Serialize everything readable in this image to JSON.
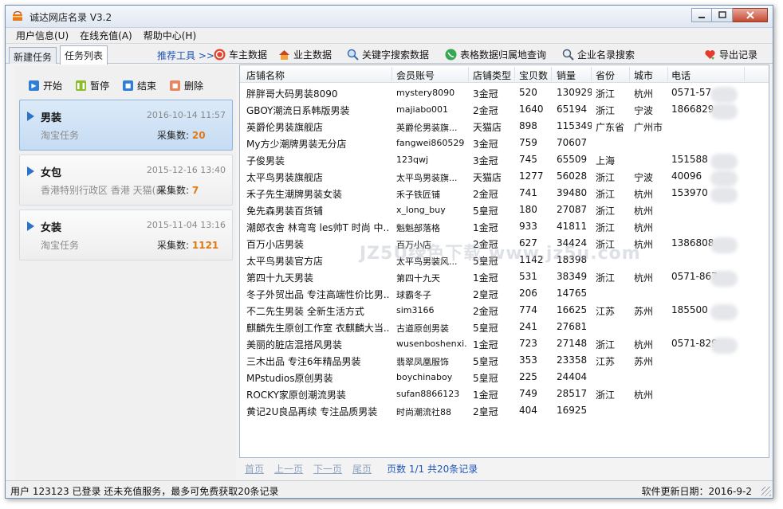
{
  "window": {
    "title": "诚达网店名录 V3.2"
  },
  "menu": [
    "用户信息(U)",
    "在线充值(A)",
    "帮助中心(H)"
  ],
  "tabs": [
    "新建任务",
    "任务列表"
  ],
  "tools": {
    "label": "推荐工具 >>",
    "items": [
      "车主数据",
      "业主数据",
      "关键字搜索数据",
      "表格数据归属地查询",
      "企业名录搜索"
    ],
    "export": "导出记录"
  },
  "actions": [
    "开始",
    "暂停",
    "结束",
    "删除"
  ],
  "tasks": [
    {
      "name": "男装",
      "date": "2016-10-14 11:57",
      "source": "淘宝任务",
      "count_label": "采集数:",
      "count": "20"
    },
    {
      "name": "女包",
      "date": "2015-12-16 13:40",
      "source": "香港特别行政区 香港 天猫(商",
      "count_label": "采集数:",
      "count": "7"
    },
    {
      "name": "女装",
      "date": "2015-11-04 13:16",
      "source": "淘宝任务",
      "count_label": "采集数:",
      "count": "1121"
    }
  ],
  "table": {
    "columns": [
      "店铺名称",
      "会员账号",
      "店铺类型",
      "宝贝数",
      "销量",
      "省份",
      "城市",
      "电话"
    ],
    "rows": [
      [
        "胖胖哥大码男装8090",
        "mystery8090",
        "3金冠",
        "520",
        "130929",
        "浙江",
        "杭州",
        "0571-57"
      ],
      [
        "GBOY潮流日系韩版男装",
        "majiabo001",
        "2金冠",
        "1640",
        "65194",
        "浙江",
        "宁波",
        "1866829"
      ],
      [
        "英爵伦男装旗舰店",
        "英爵伦男装旗...",
        "天猫店",
        "898",
        "115349",
        "广东省",
        "广州市",
        ""
      ],
      [
        "My方少潮牌男装无分店",
        "fangwei860529",
        "3金冠",
        "759",
        "70607",
        "",
        "",
        ""
      ],
      [
        "子俊男装",
        "123qwj",
        "3金冠",
        "745",
        "65509",
        "上海",
        "",
        "151588"
      ],
      [
        "太平鸟男装旗舰店",
        "太平鸟男装旗...",
        "天猫店",
        "1277",
        "56028",
        "浙江",
        "宁波",
        "40096"
      ],
      [
        "禾子先生潮牌男装女装",
        "禾子铁匠铺",
        "2金冠",
        "741",
        "39480",
        "浙江",
        "杭州",
        "153970"
      ],
      [
        "免先森男装百货铺",
        "x_long_buy",
        "5皇冠",
        "180",
        "27087",
        "浙江",
        "杭州",
        ""
      ],
      [
        "潮郎衣舍 林弯弯 les帅T 时尚 中...",
        "魁魁部落格",
        "1金冠",
        "933",
        "41811",
        "浙江",
        "杭州",
        ""
      ],
      [
        "百万小店男装",
        "百万小店",
        "2金冠",
        "627",
        "34424",
        "浙江",
        "杭州",
        "1386808"
      ],
      [
        "太平鸟男装官方店",
        "太平鸟男装风...",
        "5皇冠",
        "1142",
        "18398",
        "",
        "",
        ""
      ],
      [
        "第四十九天男装",
        "第四十九天",
        "1金冠",
        "531",
        "38349",
        "浙江",
        "杭州",
        "0571-867"
      ],
      [
        "冬子外贸出品 专注高端性价比男...",
        "球霸冬子",
        "2皇冠",
        "206",
        "14765",
        "",
        "",
        ""
      ],
      [
        "不二先生男装 全新生活方式",
        "sim3166",
        "2金冠",
        "774",
        "16625",
        "江苏",
        "苏州",
        "185500"
      ],
      [
        "麒麟先生原创工作室 衣麒麟大当...",
        "古道原创男装",
        "5皇冠",
        "241",
        "27681",
        "",
        "",
        ""
      ],
      [
        "美丽的脏店混搭风男装",
        "wusenboshenxi...",
        "1金冠",
        "723",
        "27148",
        "浙江",
        "杭州",
        "0571-829"
      ],
      [
        "三木出品 专注6年精品男装",
        "翡翠凤凰服饰",
        "5皇冠",
        "353",
        "23358",
        "江苏",
        "苏州",
        ""
      ],
      [
        "MPstudios原创男装",
        "boychinaboy",
        "5皇冠",
        "225",
        "24404",
        "",
        "",
        ""
      ],
      [
        "ROCKY家原创潮流男装",
        "sufan8866123",
        "1金冠",
        "749",
        "28517",
        "浙江",
        "杭州",
        ""
      ],
      [
        "黄记2U良品再续 专注品质男装",
        "时尚潮流社88",
        "2皇冠",
        "404",
        "16925",
        "",
        "",
        ""
      ]
    ]
  },
  "watermark": "JZ5U绿色下载 www.jz5u.com",
  "pager": {
    "first": "首页",
    "prev": "上一页",
    "next": "下一页",
    "last": "尾页",
    "info": "页数 1/1 共20条记录"
  },
  "status": {
    "left": "用户 123123 已登录 还未充值服务，最多可免费获取20条记录",
    "right": "软件更新日期：2016-9-2"
  },
  "colors": {
    "accent": "#1f55b8",
    "count": "#e17a12",
    "task_active": "#c6dcf3"
  }
}
